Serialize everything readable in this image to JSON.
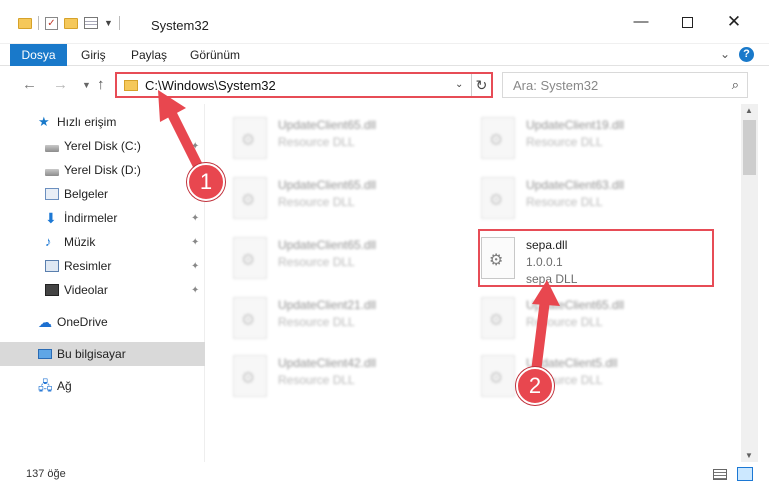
{
  "window": {
    "title": "System32"
  },
  "ribbon": {
    "tabs": [
      "Dosya",
      "Giriş",
      "Paylaş",
      "Görünüm"
    ]
  },
  "address": {
    "path": "C:\\Windows\\System32",
    "search_placeholder": "Ara: System32"
  },
  "nav": {
    "quick_access": "Hızlı erişim",
    "items": [
      {
        "label": "Yerel Disk (C:)",
        "icon": "disk-icon",
        "pinned": true
      },
      {
        "label": "Yerel Disk (D:)",
        "icon": "disk-icon",
        "pinned": true
      },
      {
        "label": "Belgeler",
        "icon": "documents-icon",
        "pinned": true
      },
      {
        "label": "İndirmeler",
        "icon": "downloads-icon",
        "pinned": true
      },
      {
        "label": "Müzik",
        "icon": "music-icon",
        "pinned": true
      },
      {
        "label": "Resimler",
        "icon": "pictures-icon",
        "pinned": true
      },
      {
        "label": "Videolar",
        "icon": "videos-icon",
        "pinned": true
      }
    ],
    "onedrive": "OneDrive",
    "this_pc": "Bu bilgisayar",
    "network": "Ağ"
  },
  "files": [
    {
      "name": "UpdateClient65.dll",
      "desc": "Resource DLL"
    },
    {
      "name": "UpdateClient19.dll",
      "desc": "Resource DLL"
    },
    {
      "name": "UpdateClient65.dll",
      "desc": "Resource DLL"
    },
    {
      "name": "UpdateClient63.dll",
      "desc": "Resource DLL"
    },
    {
      "name": "UpdateClient65.dll",
      "desc": "Resource DLL"
    },
    {
      "name": "sepa.dll",
      "version": "1.0.0.1",
      "desc": "sepa DLL"
    },
    {
      "name": "UpdateClient21.dll",
      "desc": "Resource DLL"
    },
    {
      "name": "UpdateClient65.dll",
      "desc": "Resource DLL"
    },
    {
      "name": "UpdateClient42.dll",
      "desc": "Resource DLL"
    },
    {
      "name": "UpdateClient5.dll",
      "desc": "Resource DLL"
    }
  ],
  "status": {
    "item_count": "137 öğe"
  },
  "callouts": {
    "one": "1",
    "two": "2"
  },
  "colors": {
    "accent": "#1979ca",
    "highlight": "#e74c56",
    "selection": "#cce8ff"
  }
}
